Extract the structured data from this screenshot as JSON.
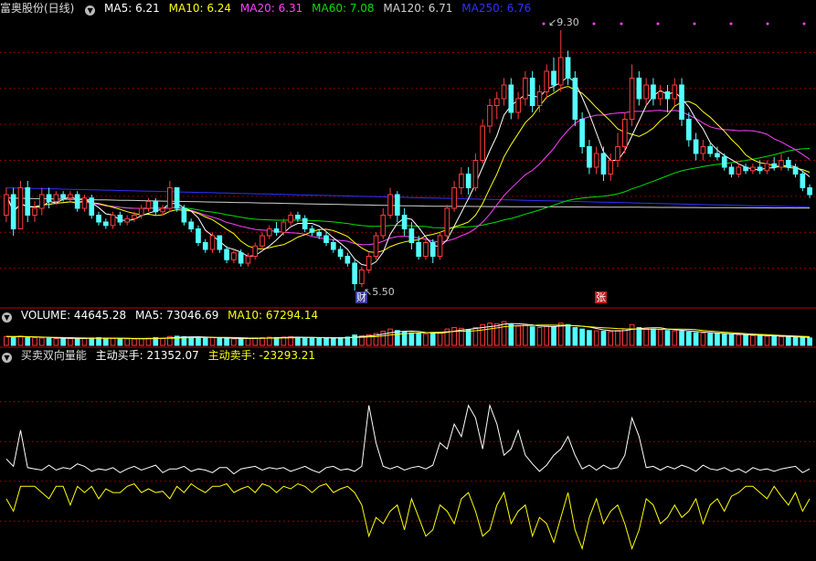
{
  "main_legend": {
    "title": "富奥股份(日线)",
    "ma5": "MA5: 6.21",
    "ma10": "MA10: 6.24",
    "ma20": "MA20: 6.31",
    "ma60": "MA60: 7.08",
    "ma120": "MA120: 6.71",
    "ma250": "MA250: 6.76"
  },
  "volume_legend": {
    "volume": "VOLUME: 44645.28",
    "ma5": "MA5: 73046.69",
    "ma10": "MA10: 67294.14"
  },
  "indicator_legend": {
    "name": "买卖双向量能",
    "buy": "主动买手: 21352.07",
    "sell": "主动卖手: -23293.21"
  },
  "annotations": {
    "high": "9.30",
    "low": "5.50",
    "cai_tag": "财",
    "zhang_tag": "张"
  },
  "colors": {
    "up": "#ff3b3b",
    "down": "#54ffff",
    "ma5": "#ffffff",
    "ma10": "#ffff00",
    "ma20": "#ff40ff",
    "ma60": "#00e000",
    "ma120": "#d0d0d0",
    "ma250": "#3030ff",
    "grid": "#8a0000"
  },
  "chart_data": {
    "type": "candlestick",
    "title": "富奥股份(日线)",
    "price_range": [
      5.3,
      9.5
    ],
    "candles": [
      [
        6.6,
        6.9,
        6.5,
        7.0
      ],
      [
        6.9,
        6.4,
        6.3,
        7.0
      ],
      [
        6.4,
        7.0,
        6.4,
        7.1
      ],
      [
        7.0,
        6.6,
        6.5,
        7.1
      ],
      [
        6.6,
        6.7,
        6.5,
        6.8
      ],
      [
        6.7,
        6.9,
        6.6,
        7.0
      ],
      [
        6.9,
        6.8,
        6.7,
        7.0
      ],
      [
        6.8,
        6.9,
        6.75,
        6.95
      ],
      [
        6.9,
        6.85,
        6.8,
        6.95
      ],
      [
        6.85,
        6.9,
        6.8,
        6.95
      ],
      [
        6.9,
        6.7,
        6.65,
        6.95
      ],
      [
        6.7,
        6.85,
        6.65,
        6.9
      ],
      [
        6.85,
        6.6,
        6.55,
        6.9
      ],
      [
        6.6,
        6.5,
        6.45,
        6.65
      ],
      [
        6.5,
        6.45,
        6.4,
        6.55
      ],
      [
        6.45,
        6.6,
        6.4,
        6.65
      ],
      [
        6.6,
        6.5,
        6.45,
        6.65
      ],
      [
        6.5,
        6.55,
        6.45,
        6.6
      ],
      [
        6.55,
        6.6,
        6.5,
        6.65
      ],
      [
        6.6,
        6.7,
        6.55,
        6.75
      ],
      [
        6.7,
        6.8,
        6.65,
        6.85
      ],
      [
        6.8,
        6.65,
        6.6,
        6.85
      ],
      [
        6.65,
        6.7,
        6.6,
        6.75
      ],
      [
        6.7,
        7.0,
        6.65,
        7.1
      ],
      [
        7.0,
        6.7,
        6.65,
        7.0
      ],
      [
        6.7,
        6.5,
        6.45,
        6.75
      ],
      [
        6.5,
        6.4,
        6.35,
        6.55
      ],
      [
        6.4,
        6.2,
        6.15,
        6.45
      ],
      [
        6.2,
        6.1,
        6.05,
        6.25
      ],
      [
        6.1,
        6.3,
        6.05,
        6.35
      ],
      [
        6.3,
        6.1,
        6.05,
        6.3
      ],
      [
        6.1,
        5.95,
        5.9,
        6.15
      ],
      [
        5.95,
        6.05,
        5.9,
        6.1
      ],
      [
        6.05,
        5.9,
        5.85,
        6.1
      ],
      [
        5.9,
        6.0,
        5.85,
        6.05
      ],
      [
        6.0,
        6.15,
        5.95,
        6.2
      ],
      [
        6.15,
        6.3,
        6.1,
        6.35
      ],
      [
        6.3,
        6.4,
        6.25,
        6.45
      ],
      [
        6.4,
        6.35,
        6.3,
        6.5
      ],
      [
        6.35,
        6.5,
        6.3,
        6.55
      ],
      [
        6.5,
        6.6,
        6.45,
        6.65
      ],
      [
        6.6,
        6.55,
        6.5,
        6.65
      ],
      [
        6.55,
        6.4,
        6.35,
        6.6
      ],
      [
        6.4,
        6.35,
        6.3,
        6.45
      ],
      [
        6.35,
        6.3,
        6.25,
        6.4
      ],
      [
        6.3,
        6.2,
        6.15,
        6.35
      ],
      [
        6.2,
        6.1,
        6.05,
        6.25
      ],
      [
        6.1,
        6.0,
        5.95,
        6.15
      ],
      [
        6.0,
        5.9,
        5.85,
        6.05
      ],
      [
        5.9,
        5.6,
        5.5,
        5.95
      ],
      [
        5.6,
        5.8,
        5.55,
        5.85
      ],
      [
        5.8,
        6.0,
        5.75,
        6.05
      ],
      [
        6.0,
        6.3,
        5.95,
        6.35
      ],
      [
        6.3,
        6.6,
        6.25,
        6.7
      ],
      [
        6.6,
        6.9,
        6.55,
        7.0
      ],
      [
        6.9,
        6.6,
        6.5,
        6.95
      ],
      [
        6.6,
        6.4,
        6.3,
        6.7
      ],
      [
        6.4,
        6.2,
        6.1,
        6.5
      ],
      [
        6.2,
        6.0,
        5.95,
        6.3
      ],
      [
        6.0,
        6.2,
        5.95,
        6.25
      ],
      [
        6.2,
        6.0,
        5.9,
        6.25
      ],
      [
        6.0,
        6.3,
        5.95,
        6.35
      ],
      [
        6.3,
        6.7,
        6.25,
        6.75
      ],
      [
        6.7,
        7.0,
        6.65,
        7.1
      ],
      [
        7.0,
        7.2,
        6.9,
        7.3
      ],
      [
        7.2,
        7.0,
        6.9,
        7.3
      ],
      [
        7.0,
        7.4,
        6.95,
        7.5
      ],
      [
        7.4,
        7.9,
        7.35,
        8.0
      ],
      [
        7.9,
        8.2,
        7.8,
        8.3
      ],
      [
        8.2,
        8.3,
        8.0,
        8.4
      ],
      [
        8.3,
        8.5,
        8.2,
        8.6
      ],
      [
        8.5,
        8.1,
        8.0,
        8.6
      ],
      [
        8.1,
        8.3,
        8.0,
        8.4
      ],
      [
        8.3,
        8.6,
        8.2,
        8.7
      ],
      [
        8.6,
        8.2,
        8.1,
        8.7
      ],
      [
        8.2,
        8.4,
        8.1,
        8.5
      ],
      [
        8.4,
        8.7,
        8.3,
        8.8
      ],
      [
        8.7,
        8.5,
        8.4,
        8.9
      ],
      [
        8.5,
        8.9,
        8.4,
        9.3
      ],
      [
        8.9,
        8.6,
        8.5,
        9.0
      ],
      [
        8.6,
        8.0,
        7.9,
        8.7
      ],
      [
        8.0,
        7.6,
        7.5,
        8.1
      ],
      [
        7.6,
        7.3,
        7.2,
        7.7
      ],
      [
        7.3,
        7.5,
        7.2,
        7.6
      ],
      [
        7.5,
        7.2,
        7.1,
        7.6
      ],
      [
        7.2,
        7.4,
        7.1,
        7.5
      ],
      [
        7.4,
        7.6,
        7.3,
        7.8
      ],
      [
        7.6,
        8.0,
        7.5,
        8.1
      ],
      [
        8.0,
        8.6,
        7.9,
        8.8
      ],
      [
        8.6,
        8.3,
        8.2,
        8.7
      ],
      [
        8.3,
        8.5,
        8.2,
        8.6
      ],
      [
        8.5,
        8.3,
        8.2,
        8.6
      ],
      [
        8.3,
        8.4,
        8.2,
        8.5
      ],
      [
        8.4,
        8.3,
        8.1,
        8.5
      ],
      [
        8.3,
        8.5,
        8.2,
        8.6
      ],
      [
        8.5,
        8.0,
        7.9,
        8.6
      ],
      [
        8.0,
        7.7,
        7.6,
        8.1
      ],
      [
        7.7,
        7.5,
        7.4,
        7.8
      ],
      [
        7.5,
        7.6,
        7.4,
        7.7
      ],
      [
        7.6,
        7.5,
        7.45,
        7.65
      ],
      [
        7.5,
        7.45,
        7.4,
        7.6
      ],
      [
        7.45,
        7.3,
        7.25,
        7.5
      ],
      [
        7.3,
        7.2,
        7.15,
        7.35
      ],
      [
        7.2,
        7.3,
        7.15,
        7.35
      ],
      [
        7.3,
        7.25,
        7.2,
        7.35
      ],
      [
        7.25,
        7.3,
        7.2,
        7.35
      ],
      [
        7.3,
        7.25,
        7.2,
        7.4
      ],
      [
        7.25,
        7.35,
        7.2,
        7.4
      ],
      [
        7.35,
        7.3,
        7.25,
        7.45
      ],
      [
        7.3,
        7.4,
        7.25,
        7.5
      ],
      [
        7.4,
        7.3,
        7.25,
        7.45
      ],
      [
        7.3,
        7.2,
        7.15,
        7.35
      ],
      [
        7.2,
        7.0,
        6.95,
        7.25
      ],
      [
        7.0,
        6.9,
        6.85,
        7.05
      ]
    ],
    "volume_range": [
      0,
      160000
    ],
    "volume": [
      60000,
      58000,
      62000,
      55000,
      52000,
      50000,
      48000,
      46000,
      47000,
      45000,
      48000,
      46000,
      50000,
      52000,
      49000,
      47000,
      45000,
      44000,
      43000,
      46000,
      48000,
      52000,
      47000,
      60000,
      62000,
      58000,
      56000,
      54000,
      50000,
      52000,
      48000,
      46000,
      44000,
      45000,
      47000,
      50000,
      52000,
      55000,
      53000,
      56000,
      58000,
      54000,
      52000,
      50000,
      49000,
      48000,
      50000,
      53000,
      56000,
      70000,
      65000,
      72000,
      80000,
      95000,
      110000,
      100000,
      90000,
      85000,
      80000,
      78000,
      82000,
      88000,
      110000,
      120000,
      115000,
      105000,
      120000,
      140000,
      150000,
      145000,
      160000,
      140000,
      130000,
      135000,
      125000,
      120000,
      130000,
      125000,
      150000,
      140000,
      120000,
      110000,
      100000,
      98000,
      95000,
      92000,
      100000,
      110000,
      140000,
      120000,
      115000,
      110000,
      105000,
      100000,
      98000,
      95000,
      90000,
      85000,
      82000,
      80000,
      78000,
      75000,
      72000,
      70000,
      68000,
      66000,
      64000,
      62000,
      60000,
      58000,
      56000,
      54000,
      52000,
      50000
    ],
    "indicator": {
      "range": [
        -80000,
        80000
      ],
      "series": [
        {
          "name": "主动买手",
          "color": "#ffffff",
          "values": [
            2000,
            -4000,
            25000,
            -5000,
            -6000,
            -7000,
            -3000,
            -7000,
            -5000,
            -6000,
            -2000,
            -4000,
            -8000,
            -6000,
            -7000,
            -5000,
            -9000,
            -6000,
            -4000,
            -7000,
            -5000,
            -3000,
            -9000,
            -6000,
            -6000,
            -4000,
            -8000,
            -6000,
            -7000,
            -9000,
            -5000,
            -5000,
            -10000,
            -6000,
            -5000,
            -4000,
            -7000,
            -5000,
            -6000,
            -5000,
            -8000,
            -6000,
            -4000,
            -7000,
            -9000,
            -5000,
            -4000,
            -7000,
            -6000,
            -8000,
            -4000,
            45000,
            15000,
            -4000,
            -6000,
            -4000,
            -7000,
            -5000,
            -4000,
            -6000,
            -3000,
            15000,
            10000,
            30000,
            20000,
            45000,
            35000,
            10000,
            45000,
            30000,
            5000,
            10000,
            25000,
            5000,
            -2000,
            -8000,
            -3000,
            5000,
            10000,
            20000,
            5000,
            -6000,
            -3000,
            -7000,
            -3000,
            -6000,
            -5000,
            5000,
            35000,
            20000,
            -5000,
            -4000,
            -7000,
            -4000,
            -6000,
            -3000,
            -5000,
            -8000,
            -3000,
            -6000,
            -7000,
            -5000,
            -8000,
            -6000,
            -9000,
            -5000,
            -7000,
            -6000,
            -8000,
            -6000,
            -5000,
            -4000,
            -9000,
            -6000
          ]
        },
        {
          "name": "主动卖手",
          "color": "#ffff00",
          "values": [
            -30000,
            -40000,
            -20000,
            -20000,
            -20000,
            -25000,
            -30000,
            -20000,
            -20000,
            -35000,
            -20000,
            -25000,
            -20000,
            -30000,
            -22000,
            -25000,
            -25000,
            -20000,
            -18000,
            -25000,
            -22000,
            -25000,
            -24000,
            -30000,
            -20000,
            -25000,
            -18000,
            -22000,
            -25000,
            -20000,
            -20000,
            -18000,
            -25000,
            -22000,
            -20000,
            -25000,
            -18000,
            -20000,
            -25000,
            -20000,
            -22000,
            -18000,
            -20000,
            -25000,
            -20000,
            -18000,
            -25000,
            -22000,
            -20000,
            -25000,
            -35000,
            -60000,
            -45000,
            -50000,
            -40000,
            -35000,
            -55000,
            -30000,
            -45000,
            -60000,
            -55000,
            -35000,
            -40000,
            -50000,
            -30000,
            -25000,
            -40000,
            -60000,
            -55000,
            -35000,
            -25000,
            -50000,
            -40000,
            -35000,
            -60000,
            -45000,
            -50000,
            -65000,
            -45000,
            -25000,
            -55000,
            -70000,
            -45000,
            -30000,
            -50000,
            -40000,
            -35000,
            -50000,
            -70000,
            -55000,
            -30000,
            -35000,
            -50000,
            -45000,
            -35000,
            -45000,
            -40000,
            -30000,
            -50000,
            -35000,
            -30000,
            -40000,
            -28000,
            -25000,
            -20000,
            -20000,
            -25000,
            -30000,
            -20000,
            -28000,
            -35000,
            -25000,
            -40000,
            -30000
          ]
        }
      ]
    }
  }
}
